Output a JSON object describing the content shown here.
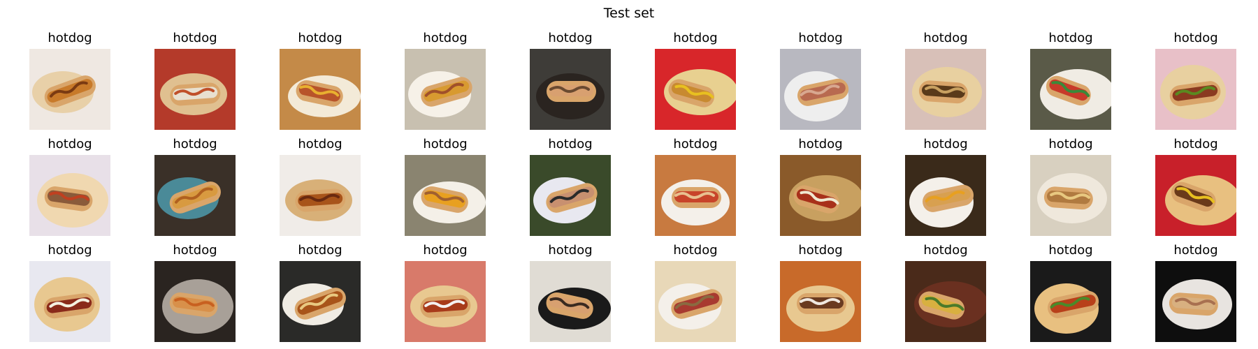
{
  "figure": {
    "title": "Test set"
  },
  "panels": [
    {
      "title": "hotdog",
      "icon": "hotdog-closeup-photo",
      "bg": "#efe8e2",
      "plate": "#e8d0a8",
      "food": "#c87a2a",
      "accent": "#7a3a12"
    },
    {
      "title": "hotdog",
      "icon": "hotdog-onions-photo",
      "bg": "#b43a2a",
      "plate": "#e0c090",
      "food": "#e8e0d0",
      "accent": "#c0502a"
    },
    {
      "title": "hotdog",
      "icon": "hotdog-juice-table-photo",
      "bg": "#c48a48",
      "plate": "#f3ead8",
      "food": "#b8542a",
      "accent": "#e8b030"
    },
    {
      "title": "hotdog",
      "icon": "hotdog-fries-box-photo",
      "bg": "#c8c0b0",
      "plate": "#f6f1e8",
      "food": "#d89a30",
      "accent": "#a0502a"
    },
    {
      "title": "hotdog",
      "icon": "person-eating-photo",
      "bg": "#3e3c38",
      "plate": "#2a2420",
      "food": "#d8a070",
      "accent": "#6a4a30"
    },
    {
      "title": "hotdog",
      "icon": "hotdog-red-tray-photo",
      "bg": "#d8262a",
      "plate": "#e8d090",
      "food": "#c88a30",
      "accent": "#e8c020"
    },
    {
      "title": "hotdog",
      "icon": "hotdog-foam-box-photo",
      "bg": "#b8b8c0",
      "plate": "#eeeeee",
      "food": "#b86a50",
      "accent": "#d8a890"
    },
    {
      "title": "hotdog",
      "icon": "chili-dog-chips-photo",
      "bg": "#d8c0b8",
      "plate": "#e8d0a0",
      "food": "#5a3a1a",
      "accent": "#c8a060"
    },
    {
      "title": "hotdog",
      "icon": "hotdog-plate-photo",
      "bg": "#5a5a48",
      "plate": "#f0ece4",
      "food": "#c83a2a",
      "accent": "#3a8a3a"
    },
    {
      "title": "hotdog",
      "icon": "hotdog-relish-photo",
      "bg": "#e8c0c8",
      "plate": "#e8d0a0",
      "food": "#8a3a20",
      "accent": "#5a8a20"
    },
    {
      "title": "hotdog",
      "icon": "chili-dog-closeup-photo",
      "bg": "#e8e0e8",
      "plate": "#f0d8b0",
      "food": "#8a5a3a",
      "accent": "#c04020"
    },
    {
      "title": "hotdog",
      "icon": "chili-dog-blue-plate-photo",
      "bg": "#3a3028",
      "plate": "#4a8a98",
      "food": "#d89a40",
      "accent": "#b06020"
    },
    {
      "title": "hotdog",
      "icon": "saucy-hotdog-photo",
      "bg": "#f0ece8",
      "plate": "#d8b078",
      "food": "#a8541a",
      "accent": "#6a2a10"
    },
    {
      "title": "hotdog",
      "icon": "cheese-dog-paper-photo",
      "bg": "#8a8470",
      "plate": "#f4f0e8",
      "food": "#e8a020",
      "accent": "#a06030"
    },
    {
      "title": "hotdog",
      "icon": "person-outdoors-photo",
      "bg": "#3a4a2a",
      "plate": "#e8e8f0",
      "food": "#c89070",
      "accent": "#2a2a2a"
    },
    {
      "title": "hotdog",
      "icon": "two-hotdogs-paper-photo",
      "bg": "#c87a40",
      "plate": "#f4f0ea",
      "food": "#c8442a",
      "accent": "#e8c090"
    },
    {
      "title": "hotdog",
      "icon": "loaded-hotdogs-photo",
      "bg": "#8a5a2a",
      "plate": "#c8a060",
      "food": "#a8301a",
      "accent": "#f0e8d0"
    },
    {
      "title": "hotdog",
      "icon": "hotdog-beer-photo",
      "bg": "#3a2a1a",
      "plate": "#f4f0ea",
      "food": "#d8a050",
      "accent": "#e8a020"
    },
    {
      "title": "hotdog",
      "icon": "hotdog-foam-tray-photo",
      "bg": "#d8d0c0",
      "plate": "#efe8dc",
      "food": "#b07a40",
      "accent": "#e8c880"
    },
    {
      "title": "hotdog",
      "icon": "hotdog-fries-red-photo",
      "bg": "#c8202a",
      "plate": "#e8c080",
      "food": "#6a3a1a",
      "accent": "#e8c020"
    },
    {
      "title": "hotdog",
      "icon": "hotdog-onions-pickle-photo",
      "bg": "#e8e8f0",
      "plate": "#e8c890",
      "food": "#8a2a1a",
      "accent": "#f4f0e0"
    },
    {
      "title": "hotdog",
      "icon": "hotdogs-foil-tray-photo",
      "bg": "#2a2420",
      "plate": "#a8a098",
      "food": "#d8904a",
      "accent": "#c86020"
    },
    {
      "title": "hotdog",
      "icon": "chili-dog-napkin-photo",
      "bg": "#2a2a28",
      "plate": "#f0ece4",
      "food": "#a8541a",
      "accent": "#e8c880"
    },
    {
      "title": "hotdog",
      "icon": "hotdog-red-paper-photo",
      "bg": "#d87a6a",
      "plate": "#e8c890",
      "food": "#a83a1a",
      "accent": "#f4f0f0"
    },
    {
      "title": "hotdog",
      "icon": "person-holding-hotdog-photo",
      "bg": "#e0dcd4",
      "plate": "#1a1a1a",
      "food": "#d8a070",
      "accent": "#3a2a20"
    },
    {
      "title": "hotdog",
      "icon": "wrapped-sausage-photo",
      "bg": "#e8d8b8",
      "plate": "#f4f0ea",
      "food": "#a83a30",
      "accent": "#8a6a40"
    },
    {
      "title": "hotdog",
      "icon": "hotdog-fries-closeup-photo",
      "bg": "#c86a2a",
      "plate": "#e8c890",
      "food": "#6a3a20",
      "accent": "#f0e8e0"
    },
    {
      "title": "hotdog",
      "icon": "loaded-nacho-dog-photo",
      "bg": "#4a2a1a",
      "plate": "#6a3020",
      "food": "#d8b040",
      "accent": "#4a7a2a"
    },
    {
      "title": "hotdog",
      "icon": "chili-dog-salad-photo",
      "bg": "#1a1a1a",
      "plate": "#e8c080",
      "food": "#b8401a",
      "accent": "#4a8a2a"
    },
    {
      "title": "hotdog",
      "icon": "hand-holding-dog-photo",
      "bg": "#0e0e0e",
      "plate": "#e8e4e0",
      "food": "#d8b080",
      "accent": "#a87050"
    }
  ]
}
